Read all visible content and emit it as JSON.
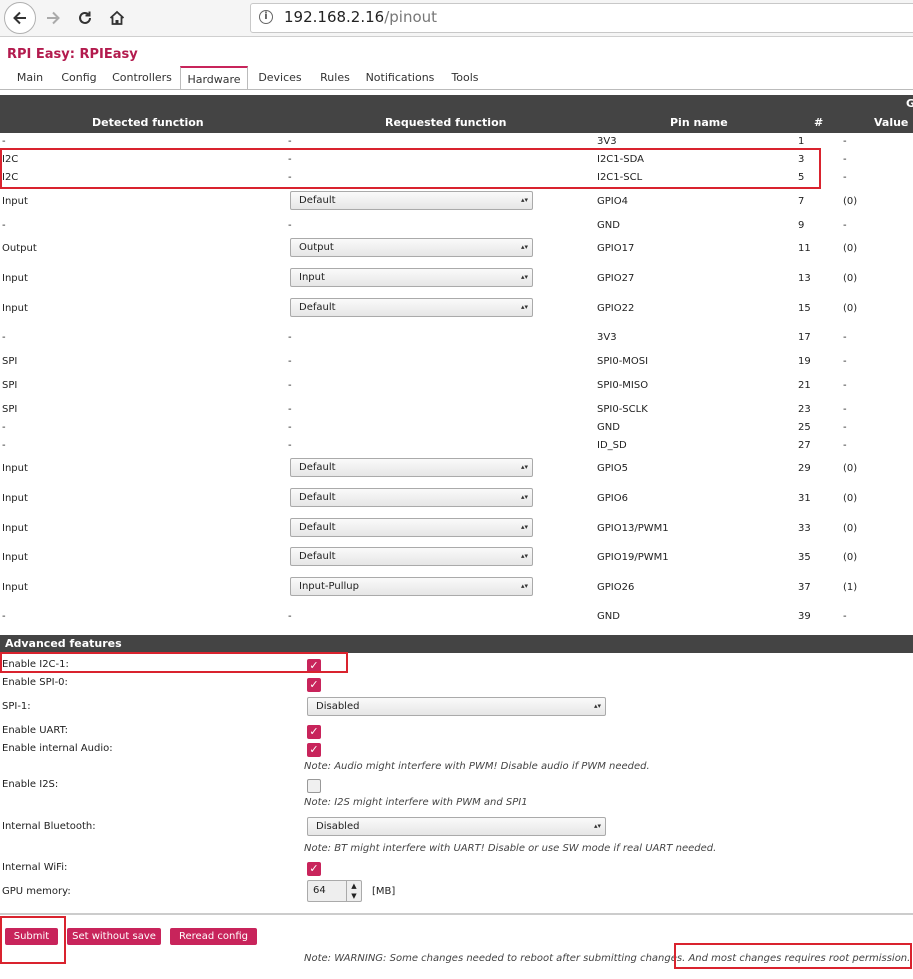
{
  "browser": {
    "url_host": "192.168.2.16",
    "url_path": "/pinout",
    "info_glyph": "i"
  },
  "app_title": "RPI Easy: RPIEasy",
  "tabs": [
    "Main",
    "Config",
    "Controllers",
    "Hardware",
    "Devices",
    "Rules",
    "Notifications",
    "Tools"
  ],
  "active_tab": "Hardware",
  "table": {
    "header_top": "G",
    "headers": [
      "Detected function",
      "Requested function",
      "Pin name",
      "#",
      "Value"
    ],
    "rows": [
      {
        "detected": "-",
        "requested": "-",
        "pin": "3V3",
        "num": "1",
        "value": "-"
      },
      {
        "detected": "I2C",
        "requested": "-",
        "pin": "I2C1-SDA",
        "num": "3",
        "value": "-"
      },
      {
        "detected": "I2C",
        "requested": "-",
        "pin": "I2C1-SCL",
        "num": "5",
        "value": "-"
      },
      {
        "detected": "Input",
        "requested": "Default",
        "pin": "GPIO4",
        "num": "7",
        "value": "(0)"
      },
      {
        "detected": "-",
        "requested": "-",
        "pin": "GND",
        "num": "9",
        "value": "-"
      },
      {
        "detected": "Output",
        "requested": "Output",
        "pin": "GPIO17",
        "num": "11",
        "value": "(0)"
      },
      {
        "detected": "Input",
        "requested": "Input",
        "pin": "GPIO27",
        "num": "13",
        "value": "(0)"
      },
      {
        "detected": "Input",
        "requested": "Default",
        "pin": "GPIO22",
        "num": "15",
        "value": "(0)"
      },
      {
        "detected": "-",
        "requested": "-",
        "pin": "3V3",
        "num": "17",
        "value": "-"
      },
      {
        "detected": "SPI",
        "requested": "-",
        "pin": "SPI0-MOSI",
        "num": "19",
        "value": "-"
      },
      {
        "detected": "SPI",
        "requested": "-",
        "pin": "SPI0-MISO",
        "num": "21",
        "value": "-"
      },
      {
        "detected": "SPI",
        "requested": "-",
        "pin": "SPI0-SCLK",
        "num": "23",
        "value": "-"
      },
      {
        "detected": "-",
        "requested": "-",
        "pin": "GND",
        "num": "25",
        "value": "-"
      },
      {
        "detected": "-",
        "requested": "-",
        "pin": "ID_SD",
        "num": "27",
        "value": "-"
      },
      {
        "detected": "Input",
        "requested": "Default",
        "pin": "GPIO5",
        "num": "29",
        "value": "(0)"
      },
      {
        "detected": "Input",
        "requested": "Default",
        "pin": "GPIO6",
        "num": "31",
        "value": "(0)"
      },
      {
        "detected": "Input",
        "requested": "Default",
        "pin": "GPIO13/PWM1",
        "num": "33",
        "value": "(0)"
      },
      {
        "detected": "Input",
        "requested": "Default",
        "pin": "GPIO19/PWM1",
        "num": "35",
        "value": "(0)"
      },
      {
        "detected": "Input",
        "requested": "Input-Pullup",
        "pin": "GPIO26",
        "num": "37",
        "value": "(1)"
      },
      {
        "detected": "-",
        "requested": "-",
        "pin": "GND",
        "num": "39",
        "value": "-"
      }
    ]
  },
  "advanced": {
    "title": "Advanced features",
    "enable_i2c1": {
      "label": "Enable I2C-1:",
      "checked": true
    },
    "enable_spi0": {
      "label": "Enable SPI-0:",
      "checked": true
    },
    "spi1": {
      "label": "SPI-1:",
      "value": "Disabled"
    },
    "enable_uart": {
      "label": "Enable UART:",
      "checked": true
    },
    "enable_audio": {
      "label": "Enable internal Audio:",
      "checked": true,
      "note": "Note: Audio might interfere with PWM! Disable audio if PWM needed."
    },
    "enable_i2s": {
      "label": "Enable I2S:",
      "checked": false,
      "note": "Note: I2S might interfere with PWM and SPI1"
    },
    "bluetooth": {
      "label": "Internal Bluetooth:",
      "value": "Disabled",
      "note": "Note: BT might interfere with UART! Disable or use SW mode if real UART needed."
    },
    "wifi": {
      "label": "Internal WiFi:",
      "checked": true
    },
    "gpu": {
      "label": "GPU memory:",
      "value": "64",
      "unit": "[MB]"
    }
  },
  "buttons": {
    "submit": "Submit",
    "set_without_save": "Set without save",
    "reread": "Reread config"
  },
  "footer_note_a": "Note: WARNING: Some changes needed to reboot after submitting changes.",
  "footer_note_b": "And most changes requires root permission.",
  "glyphs": {
    "check": "✓",
    "select_arrow": "▴▾",
    "spin_up": "▲",
    "spin_down": "▼"
  },
  "colors": {
    "accent": "#c8245b",
    "title": "#b31b4e",
    "header_bg": "#444444",
    "highlight_box": "#d9232e"
  }
}
